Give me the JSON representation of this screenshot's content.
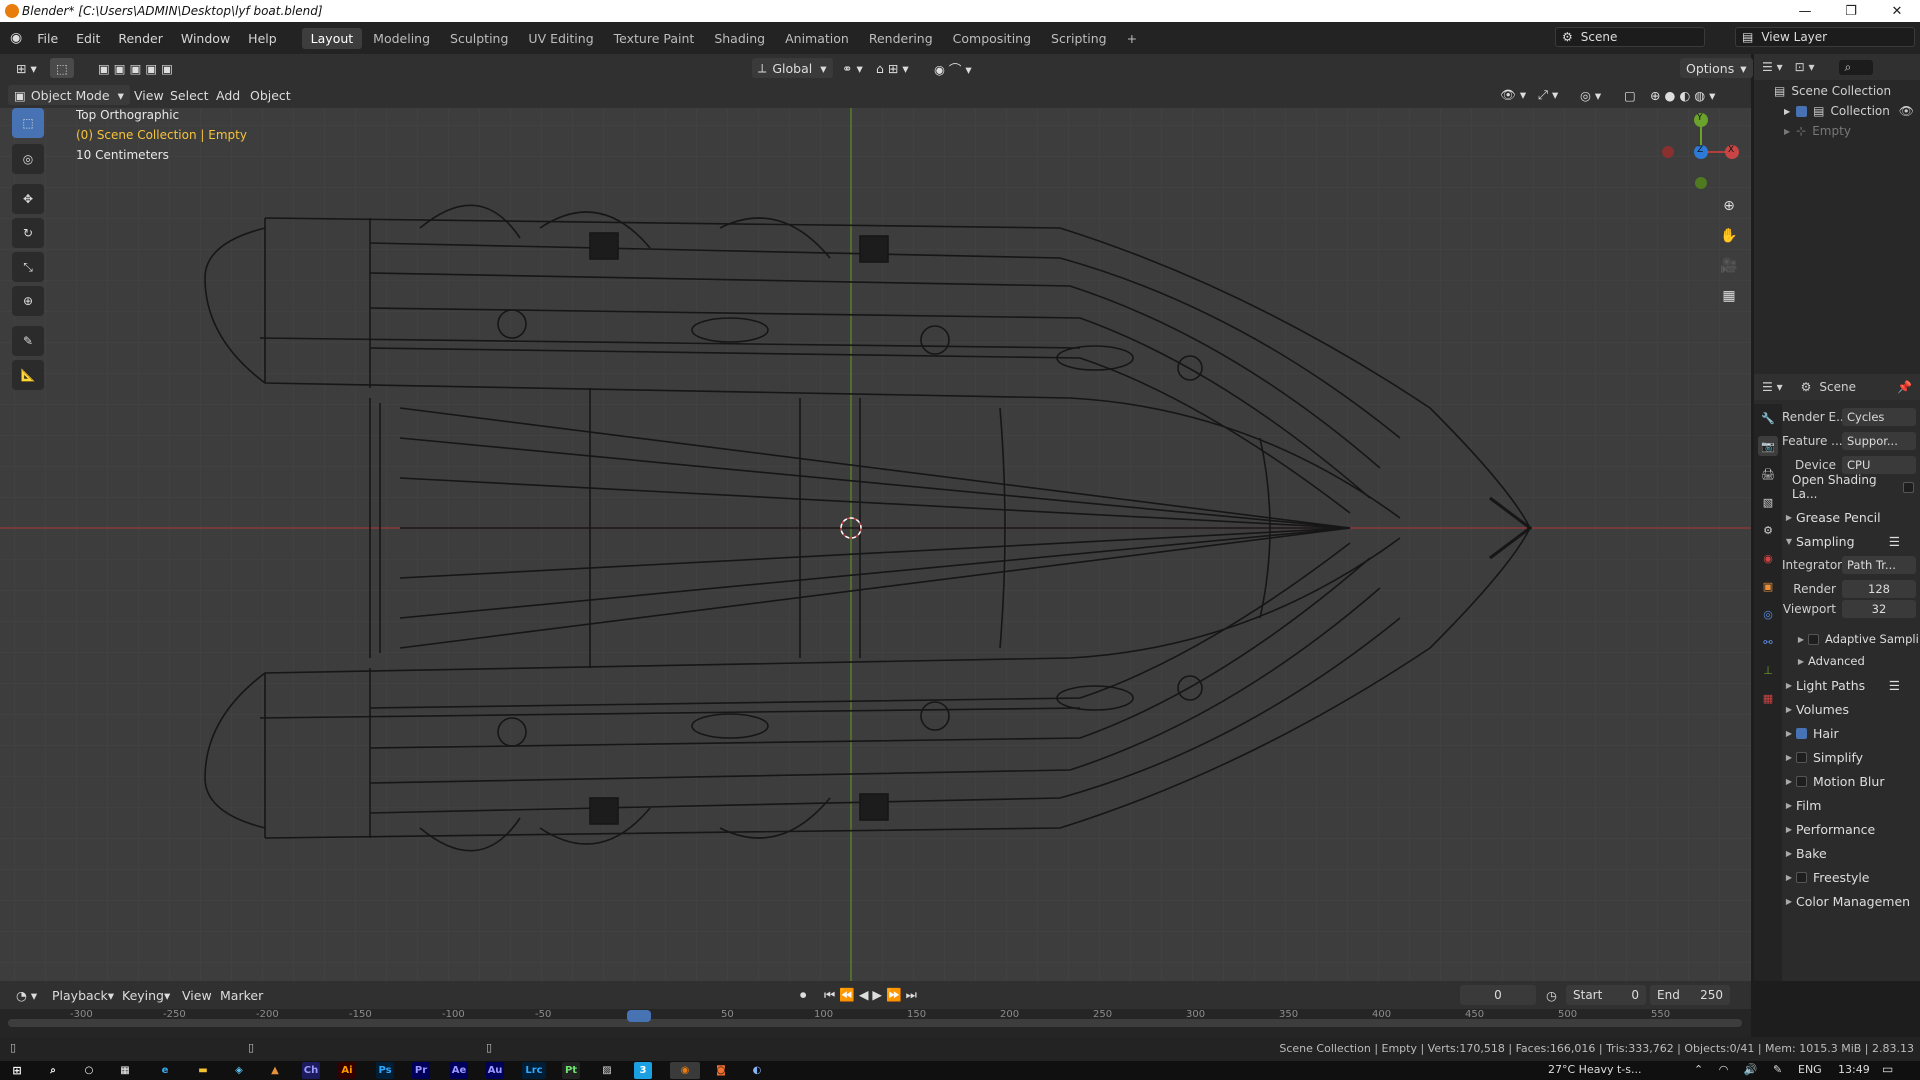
{
  "window": {
    "title": "Blender* [C:\\Users\\ADMIN\\Desktop\\lyf boat.blend]",
    "minimize": "—",
    "restore": "❐",
    "close": "✕"
  },
  "menu": [
    "File",
    "Edit",
    "Render",
    "Window",
    "Help"
  ],
  "workspaces": [
    "Layout",
    "Modeling",
    "Sculpting",
    "UV Editing",
    "Texture Paint",
    "Shading",
    "Animation",
    "Rendering",
    "Compositing",
    "Scripting"
  ],
  "active_workspace": "Layout",
  "scene_field": "Scene",
  "view_layer_field": "View Layer",
  "viewport_header": {
    "transform_orientation": "Global",
    "options": "Options"
  },
  "mode_header": {
    "mode": "Object Mode",
    "view": "View",
    "select": "Select",
    "add": "Add",
    "object": "Object"
  },
  "overlay": {
    "view_name": "Top Orthographic",
    "collection_info": "(0) Scene Collection | Empty",
    "scale": "10 Centimeters"
  },
  "gizmo": {
    "y": "Y",
    "x": "X",
    "z": "Z"
  },
  "outliner": {
    "scene_collection": "Scene Collection",
    "collection": "Collection",
    "empty": "Empty"
  },
  "properties": {
    "header": "Scene",
    "render_engine_label": "Render E...",
    "render_engine_value": "Cycles",
    "feature_label": "Feature ...",
    "feature_value": "Suppor...",
    "device_label": "Device",
    "device_value": "CPU",
    "osl_label": "Open Shading La...",
    "panels": {
      "grease_pencil": "Grease Pencil",
      "sampling": "Sampling",
      "integrator_label": "Integrator",
      "integrator_value": "Path Tr...",
      "render_label": "Render",
      "render_value": "128",
      "viewport_label": "Viewport",
      "viewport_value": "32",
      "adaptive": "Adaptive Sampli",
      "advanced": "Advanced",
      "light_paths": "Light Paths",
      "volumes": "Volumes",
      "hair": "Hair",
      "simplify": "Simplify",
      "motion_blur": "Motion Blur",
      "film": "Film",
      "performance": "Performance",
      "bake": "Bake",
      "freestyle": "Freestyle",
      "color_management": "Color Managemen"
    }
  },
  "timeline_header": {
    "playback": "Playback",
    "keying": "Keying",
    "view": "View",
    "marker": "Marker",
    "current_frame": "0",
    "start_label": "Start",
    "start_value": "0",
    "end_label": "End",
    "end_value": "250"
  },
  "timeline_ruler": [
    "-300",
    "-250",
    "-200",
    "-150",
    "-100",
    "-50",
    "0",
    "50",
    "100",
    "150",
    "200",
    "250",
    "300",
    "350",
    "400",
    "450",
    "500",
    "550"
  ],
  "status": "Scene Collection | Empty | Verts:170,518 | Faces:166,016 | Tris:333,762 | Objects:0/41 | Mem: 1015.3 MiB | 2.83.13",
  "taskbar": {
    "weather": "27°C  Heavy t-s...",
    "lang": "ENG",
    "time": "13:49",
    "apps": [
      "Ch",
      "Ai",
      "Ps",
      "Pr",
      "Ae",
      "Au",
      "Lrc",
      "Pt",
      "3"
    ]
  },
  "colors": {
    "accent": "#4772b3",
    "x_axis": "#b43e3e",
    "y_axis": "#6ba22b",
    "z_axis": "#2d7ad8",
    "viewport_bg": "#3d3d3d",
    "wire": "#1a1a1a"
  }
}
